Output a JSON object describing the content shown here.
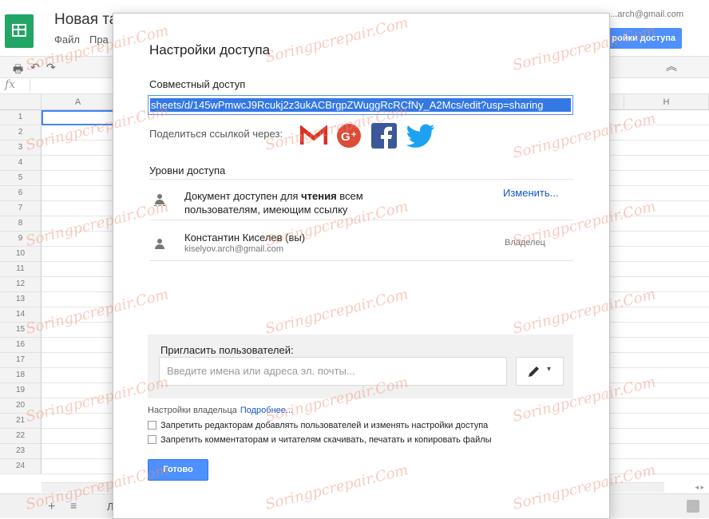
{
  "app": {
    "doc_title": "Новая та",
    "menu": [
      "Файл",
      "Пра"
    ],
    "account": "...arch@gmail.com",
    "share_button": "ройки доступа"
  },
  "sheet": {
    "fx": "fx",
    "columns": [
      "A",
      "H"
    ],
    "rows": [
      "1",
      "2",
      "3",
      "4",
      "5",
      "6",
      "7",
      "8",
      "9",
      "10",
      "11",
      "12",
      "13",
      "14",
      "15",
      "16",
      "17",
      "18",
      "19",
      "20",
      "21",
      "22",
      "23",
      "24"
    ],
    "sheet_tab": "Л"
  },
  "dialog": {
    "title": "Настройки доступа",
    "shared_access_label": "Совместный доступ",
    "link": "sheets/d/145wPmwcJ9Rcukj2z3ukACBrgpZWuggRcRCfNy_A2Mcs/edit?usp=sharing",
    "share_via_label": "Поделиться ссылкой через:",
    "social": [
      "gmail-icon",
      "google-plus-icon",
      "facebook-icon",
      "twitter-icon"
    ],
    "access_levels_label": "Уровни доступа",
    "permission": {
      "line1_prefix": "Документ доступен для ",
      "line1_bold": "чтения",
      "line1_suffix": " всем",
      "line2": "пользователям, имеющим ссылку",
      "change_link": "Изменить..."
    },
    "owner": {
      "name": "Константин Киселев (вы)",
      "email": "kiselyov.arch@gmail.com",
      "role": "Владелец"
    },
    "invite": {
      "label": "Пригласить пользователей:",
      "placeholder": "Введите имена или адреса эл. почты..."
    },
    "owner_settings": {
      "label": "Настройки владельца",
      "more_link": "Подробнее..."
    },
    "checkboxes": [
      "Запретить редакторам добавлять пользователей и изменять настройки доступа",
      "Запретить комментаторам и читателям скачивать, печатать и копировать файлы"
    ],
    "done_button": "Готово"
  },
  "watermark": "Soringpcrepair.Com",
  "colors": {
    "accent": "#4d90fe",
    "link": "#1155cc",
    "gmail": "#d93025",
    "google_plus": "#dd4b39",
    "facebook": "#3b5998",
    "twitter": "#1da1f2",
    "sheets_green": "#23a566"
  }
}
